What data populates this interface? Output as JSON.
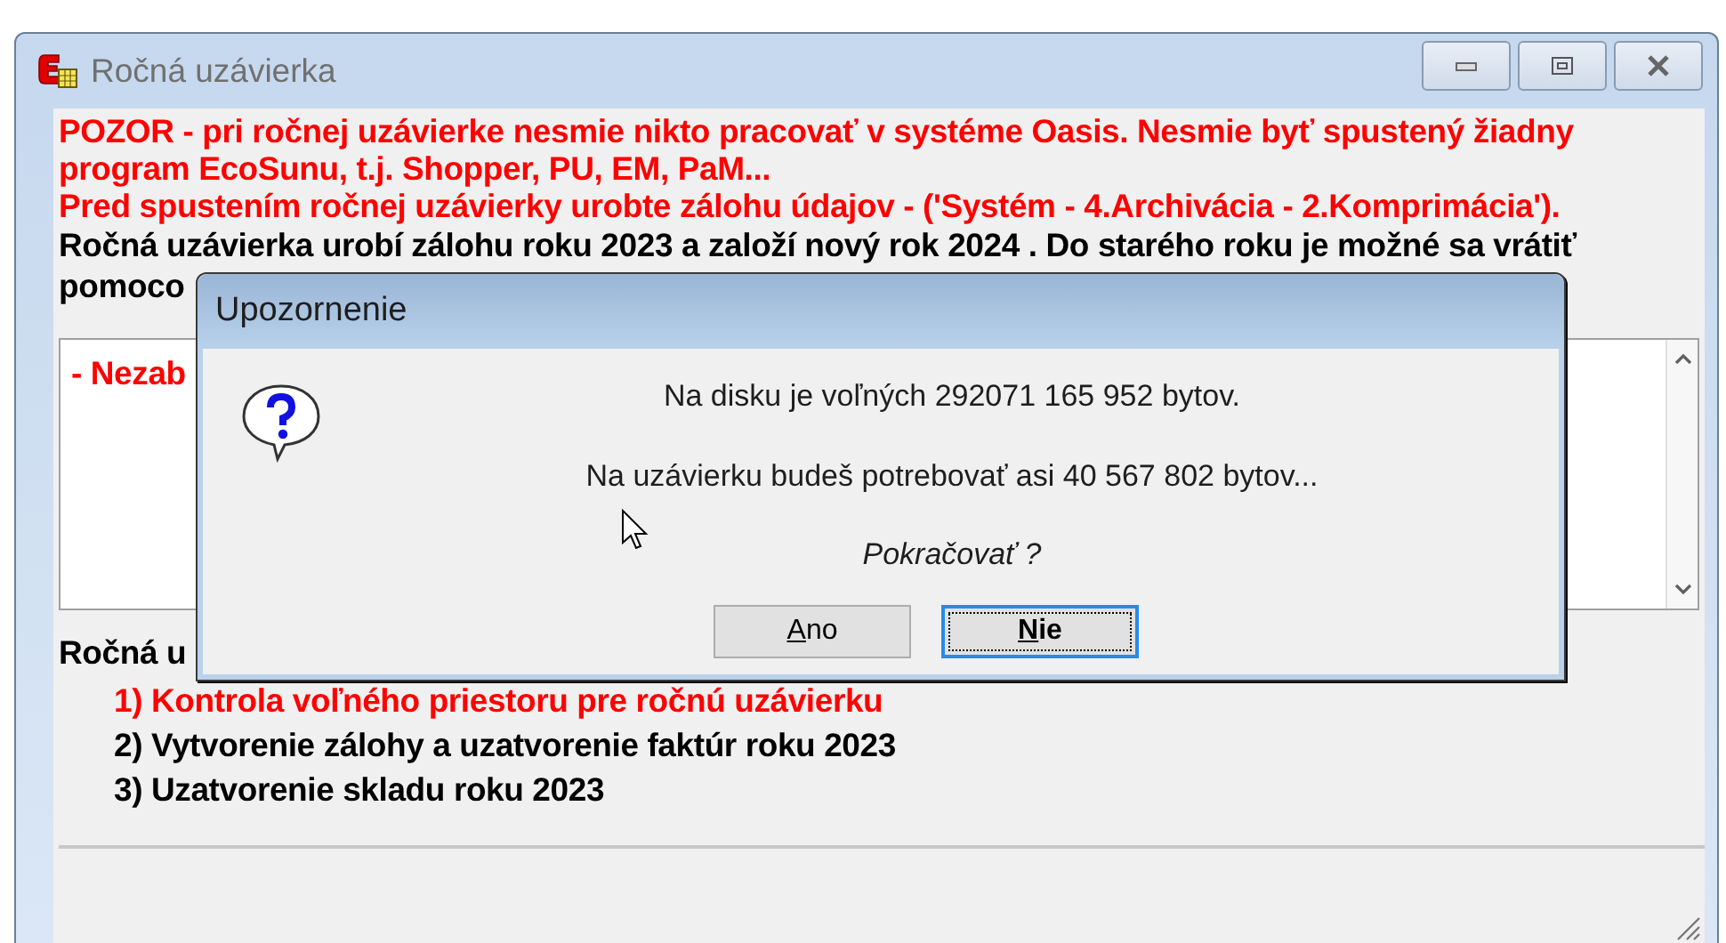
{
  "window": {
    "title": "Ročná uzávierka"
  },
  "warnings": [
    "POZOR - pri ročnej uzávierke nesmie nikto pracovať v systéme Oasis. Nesmie byť spustený žiadny program EcoSunu, t.j. Shopper, PU, EM, PaM...",
    "Pred spustením ročnej uzávierky urobte zálohu údajov - ('Systém - 4.Archivácia - 2.Komprimácia')."
  ],
  "info": [
    "Ročná uzávierka urobí zálohu roku 2023 a založí nový rok 2024 . Do starého roku je možné sa vrátiť",
    "pomoco"
  ],
  "list_items": [
    "- Nezab"
  ],
  "steps_heading": "Ročná u",
  "steps": [
    {
      "text": "1) Kontrola voľného priestoru pre ročnú uzávierku",
      "current": true
    },
    {
      "text": "2) Vytvorenie zálohy a uzatvorenie faktúr roku  2023",
      "current": false
    },
    {
      "text": "3) Uzatvorenie skladu roku  2023",
      "current": false
    }
  ],
  "dialog": {
    "title": "Upozornenie",
    "messages": [
      {
        "text": "Na disku je voľných 292071 165 952 bytov.",
        "kind": "plain"
      },
      {
        "text": "Na uzávierku budeš potrebovať asi 40 567 802 bytov...",
        "kind": "plain"
      },
      {
        "text": "Pokračovať ?",
        "kind": "question"
      }
    ],
    "buttons": [
      {
        "label": "Ano",
        "selected": false
      },
      {
        "label": "Nie",
        "selected": true
      }
    ]
  }
}
